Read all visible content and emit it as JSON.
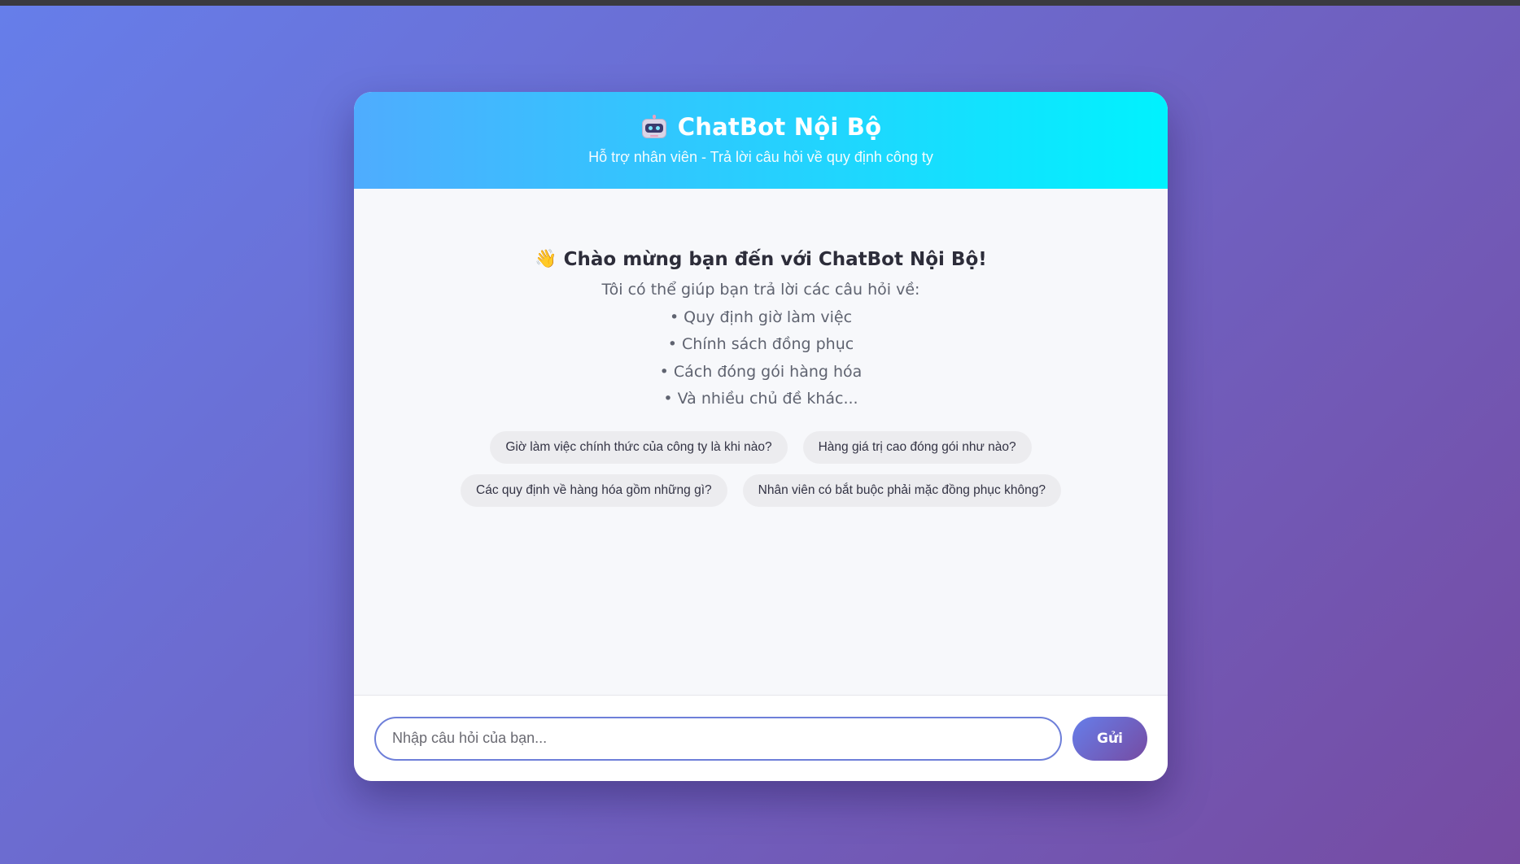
{
  "header": {
    "title": "ChatBot Nội Bộ",
    "subtitle": "Hỗ trợ nhân viên - Trả lời câu hỏi về quy định công ty",
    "icon": "robot-icon"
  },
  "welcome": {
    "icon": "waving-hand-icon",
    "title": "Chào mừng bạn đến với ChatBot Nội Bộ!",
    "intro": "Tôi có thể giúp bạn trả lời các câu hỏi về:",
    "bullets": [
      "• Quy định giờ làm việc",
      "• Chính sách đồng phục",
      "• Cách đóng gói hàng hóa",
      "• Và nhiều chủ đề khác..."
    ]
  },
  "suggestions": [
    [
      "Giờ làm việc chính thức của công ty là khi nào?",
      "Hàng giá trị cao đóng gói như nào?"
    ],
    [
      "Các quy định về hàng hóa gồm những gì?",
      "Nhân viên có bắt buộc phải mặc đồng phục không?"
    ]
  ],
  "input": {
    "placeholder": "Nhập câu hỏi của bạn...",
    "value": ""
  },
  "send_label": "Gửi",
  "colors": {
    "background_gradient": [
      "#667eea",
      "#764ba2"
    ],
    "header_gradient": [
      "#4facfe",
      "#00f2fe"
    ],
    "input_border": "#6e7fd9"
  }
}
